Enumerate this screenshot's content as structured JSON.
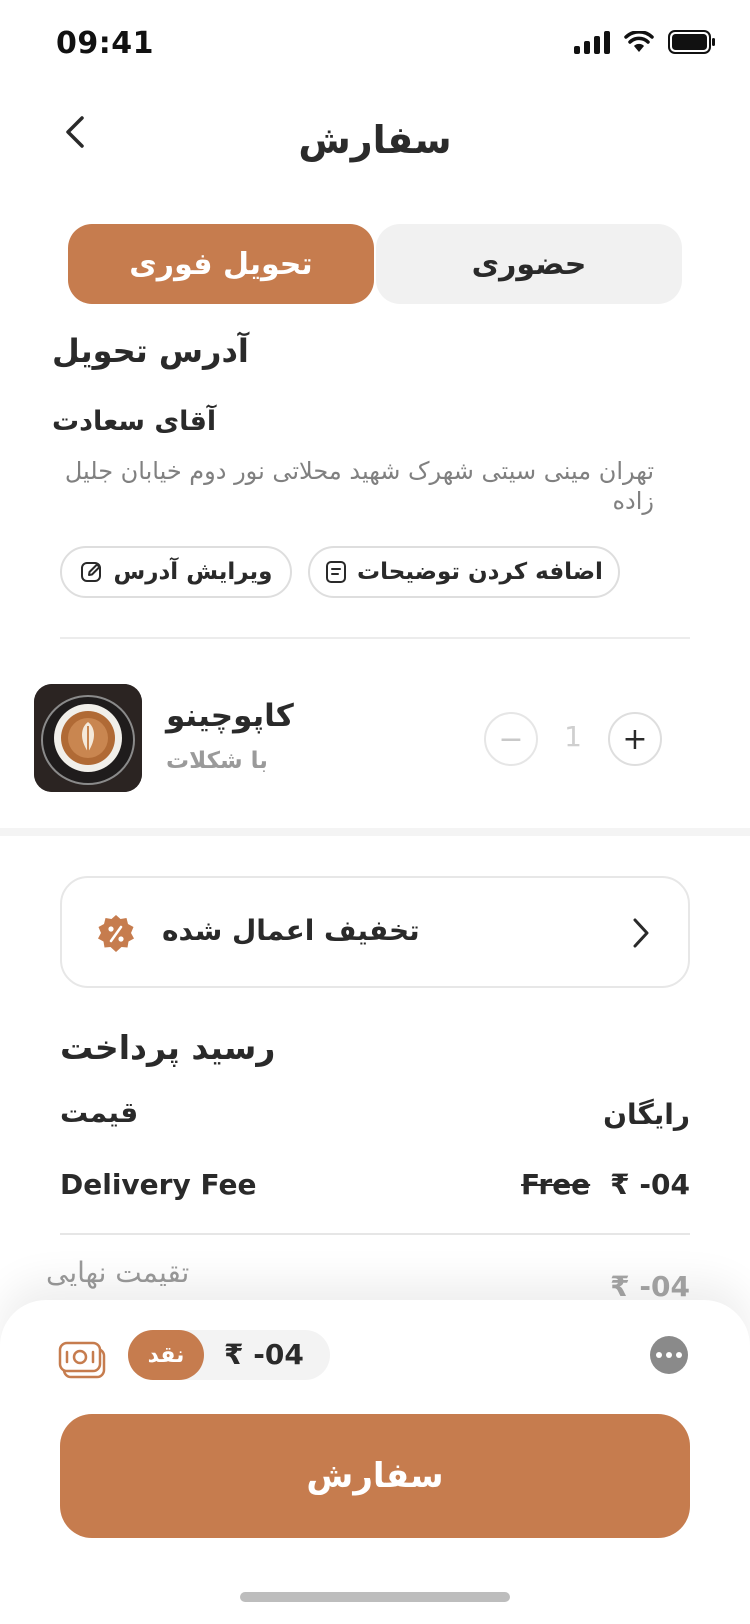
{
  "status_bar": {
    "time": "09:41"
  },
  "header": {
    "title": "سفارش"
  },
  "tabs": {
    "active": "تحویل فوری",
    "inactive": "حضوری"
  },
  "address": {
    "section_title": "آدرس تحویل",
    "name": "آقای سعادت",
    "line": "تهران مینی سیتی شهرک شهید محلاتی نور دوم خیابان جلیل زاده",
    "edit_label": "ویرایش آدرس",
    "note_label": "اضافه کردن توضیحات"
  },
  "product": {
    "name": "کاپوچینو",
    "subtitle": "با شکلات",
    "quantity": "1",
    "minus": "−",
    "plus": "+"
  },
  "discount": {
    "label": "تخفیف اعمال شده"
  },
  "receipt": {
    "title": "رسید پرداخت",
    "price_label": "قیمت",
    "price_value": "رایگان",
    "delivery_label": "Delivery Fee",
    "delivery_old": "Free",
    "delivery_value": "₹ -04",
    "final_label": "تقیمت نهایی",
    "final_value": "₹ -04"
  },
  "payment": {
    "method": "نقد",
    "amount": "₹ -04"
  },
  "order_button": {
    "label": "سفارش"
  },
  "colors": {
    "accent": "#c67c4e",
    "text": "#2a2a2a",
    "muted": "#9a9a9a"
  },
  "icons": [
    "back-chevron-icon",
    "edit-icon",
    "note-icon",
    "discount-badge-icon",
    "chevron-right-icon",
    "cash-icon",
    "more-icon"
  ]
}
